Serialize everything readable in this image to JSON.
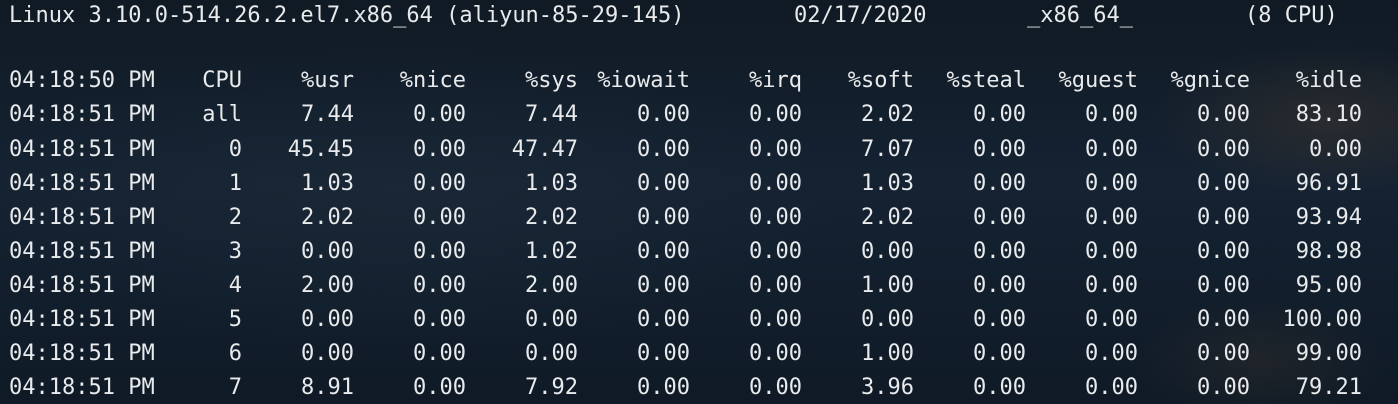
{
  "header": {
    "kernel": "Linux 3.10.0-514.26.2.el7.x86_64 (aliyun-85-29-145)",
    "date": "02/17/2020",
    "arch": "_x86_64_",
    "cpus": "(8 CPU)"
  },
  "columns": {
    "time": "04:18:50 PM",
    "cpu": "CPU",
    "usr": "%usr",
    "nice": "%nice",
    "sys": "%sys",
    "iowait": "%iowait",
    "irq": "%irq",
    "soft": "%soft",
    "steal": "%steal",
    "guest": "%guest",
    "gnice": "%gnice",
    "idle": "%idle"
  },
  "rows": [
    {
      "time": "04:18:51 PM",
      "cpu": "all",
      "usr": "7.44",
      "nice": "0.00",
      "sys": "7.44",
      "iowait": "0.00",
      "irq": "0.00",
      "soft": "2.02",
      "steal": "0.00",
      "guest": "0.00",
      "gnice": "0.00",
      "idle": "83.10"
    },
    {
      "time": "04:18:51 PM",
      "cpu": "0",
      "usr": "45.45",
      "nice": "0.00",
      "sys": "47.47",
      "iowait": "0.00",
      "irq": "0.00",
      "soft": "7.07",
      "steal": "0.00",
      "guest": "0.00",
      "gnice": "0.00",
      "idle": "0.00"
    },
    {
      "time": "04:18:51 PM",
      "cpu": "1",
      "usr": "1.03",
      "nice": "0.00",
      "sys": "1.03",
      "iowait": "0.00",
      "irq": "0.00",
      "soft": "1.03",
      "steal": "0.00",
      "guest": "0.00",
      "gnice": "0.00",
      "idle": "96.91"
    },
    {
      "time": "04:18:51 PM",
      "cpu": "2",
      "usr": "2.02",
      "nice": "0.00",
      "sys": "2.02",
      "iowait": "0.00",
      "irq": "0.00",
      "soft": "2.02",
      "steal": "0.00",
      "guest": "0.00",
      "gnice": "0.00",
      "idle": "93.94"
    },
    {
      "time": "04:18:51 PM",
      "cpu": "3",
      "usr": "0.00",
      "nice": "0.00",
      "sys": "1.02",
      "iowait": "0.00",
      "irq": "0.00",
      "soft": "0.00",
      "steal": "0.00",
      "guest": "0.00",
      "gnice": "0.00",
      "idle": "98.98"
    },
    {
      "time": "04:18:51 PM",
      "cpu": "4",
      "usr": "2.00",
      "nice": "0.00",
      "sys": "2.00",
      "iowait": "0.00",
      "irq": "0.00",
      "soft": "1.00",
      "steal": "0.00",
      "guest": "0.00",
      "gnice": "0.00",
      "idle": "95.00"
    },
    {
      "time": "04:18:51 PM",
      "cpu": "5",
      "usr": "0.00",
      "nice": "0.00",
      "sys": "0.00",
      "iowait": "0.00",
      "irq": "0.00",
      "soft": "0.00",
      "steal": "0.00",
      "guest": "0.00",
      "gnice": "0.00",
      "idle": "100.00"
    },
    {
      "time": "04:18:51 PM",
      "cpu": "6",
      "usr": "0.00",
      "nice": "0.00",
      "sys": "0.00",
      "iowait": "0.00",
      "irq": "0.00",
      "soft": "1.00",
      "steal": "0.00",
      "guest": "0.00",
      "gnice": "0.00",
      "idle": "99.00"
    },
    {
      "time": "04:18:51 PM",
      "cpu": "7",
      "usr": "8.91",
      "nice": "0.00",
      "sys": "7.92",
      "iowait": "0.00",
      "irq": "0.00",
      "soft": "3.96",
      "steal": "0.00",
      "guest": "0.00",
      "gnice": "0.00",
      "idle": "79.21"
    }
  ]
}
